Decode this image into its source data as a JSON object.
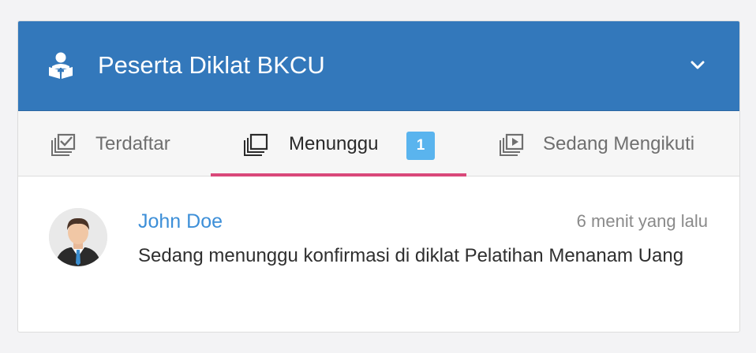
{
  "header": {
    "title": "Peserta Diklat BKCU",
    "icon": "user-book-icon",
    "collapse_icon": "chevron-down-icon",
    "background_color": "#3378bb"
  },
  "tabs": [
    {
      "label": "Terdaftar",
      "icon": "checked-cards-icon",
      "active": false
    },
    {
      "label": "Menunggu",
      "icon": "stacked-cards-icon",
      "active": true,
      "badge": "1"
    },
    {
      "label": "Sedang Mengikuti",
      "icon": "play-cards-icon",
      "active": false
    }
  ],
  "feed": [
    {
      "user": "John Doe",
      "time": "6 menit yang lalu",
      "message": "Sedang menunggu konfirmasi di diklat Pelatihan Menanam Uang",
      "avatar": "businessman-avatar"
    }
  ],
  "colors": {
    "accent_underline": "#d9487a",
    "badge": "#5ab4ee",
    "link": "#3d8fd8"
  }
}
